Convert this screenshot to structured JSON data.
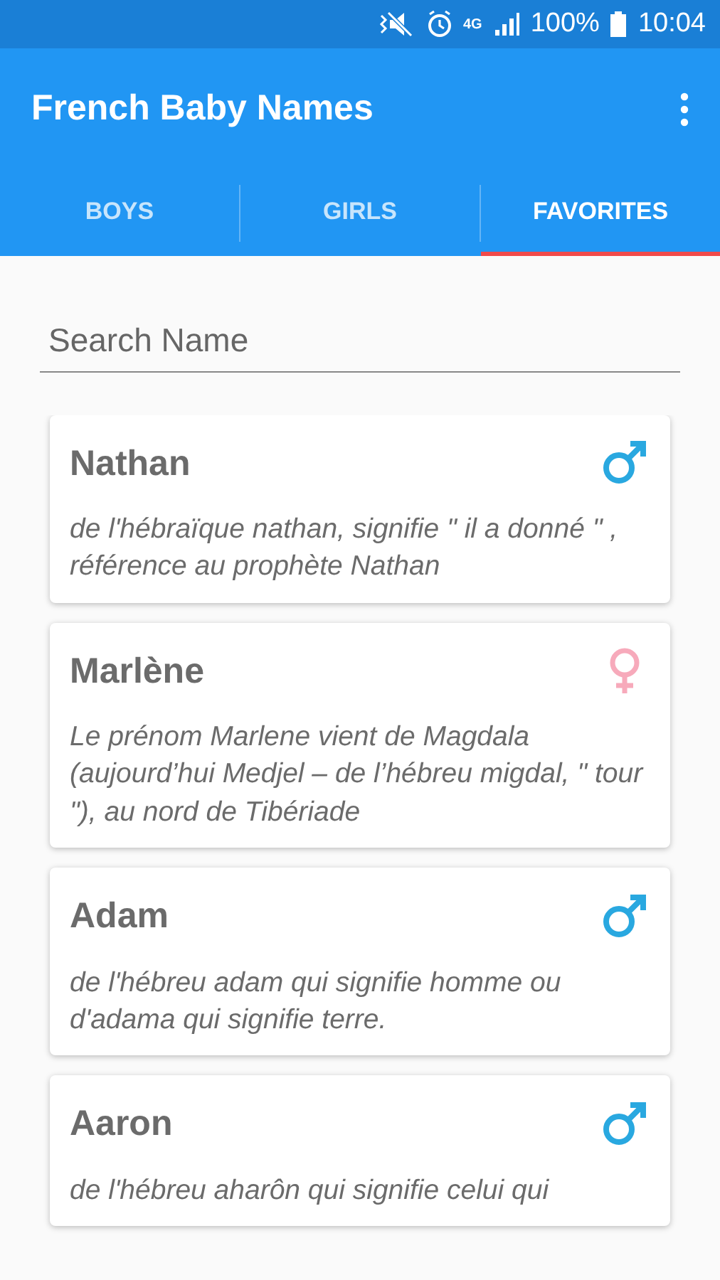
{
  "status_bar": {
    "signal_label": "4G",
    "battery": "100%",
    "time": "10:04"
  },
  "app_bar": {
    "title": "French Baby Names"
  },
  "tabs": [
    {
      "label": "BOYS",
      "selected": false
    },
    {
      "label": "GIRLS",
      "selected": false
    },
    {
      "label": "FAVORITES",
      "selected": true
    }
  ],
  "search": {
    "placeholder": "Search Name"
  },
  "names": [
    {
      "name": "Nathan",
      "kind": "male",
      "description": "de l'hébraïque nathan, signifie \" il a donné \" , référence au prophète Nathan"
    },
    {
      "name": "Marlène",
      "kind": "female",
      "description": "Le prénom Marlene vient de Magdala (aujourd’hui Medjel – de l’hébreu migdal, \" tour \"), au nord de Tibériade"
    },
    {
      "name": "Adam",
      "kind": "male",
      "description": "de l'hébreu adam qui signifie homme ou d'adama qui signifie terre."
    },
    {
      "name": "Aaron",
      "kind": "male",
      "description": "de l'hébreu aharôn qui signifie celui qui"
    }
  ]
}
